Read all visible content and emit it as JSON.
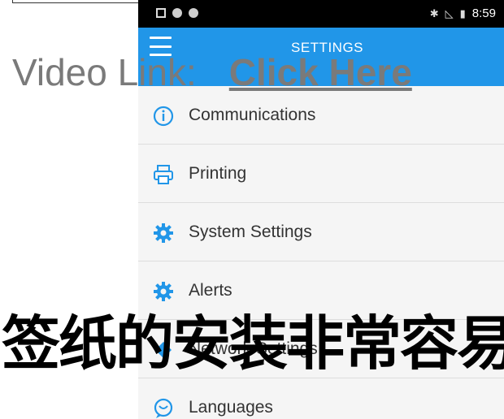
{
  "status_bar": {
    "time": "8:59",
    "icons": [
      "image-icon",
      "circle-icon",
      "circle-icon",
      "bluetooth-icon",
      "no-signal-icon",
      "battery-icon"
    ]
  },
  "app_bar": {
    "title": "SETTINGS",
    "menu_icon": "hamburger-icon",
    "color": "#2196e8"
  },
  "menu": {
    "items": [
      {
        "label": "Communications",
        "icon": "info-icon"
      },
      {
        "label": "Printing",
        "icon": "printer-icon"
      },
      {
        "label": "System Settings",
        "icon": "gear-icon"
      },
      {
        "label": "Alerts",
        "icon": "gear-icon"
      },
      {
        "label": "Network Settings",
        "icon": "network-icon"
      },
      {
        "label": "Languages",
        "icon": "chat-icon"
      }
    ]
  },
  "overlay": {
    "video_label": "Video Link:",
    "video_link": "Click Here",
    "caption_cn": "签纸的安装非常容易"
  }
}
